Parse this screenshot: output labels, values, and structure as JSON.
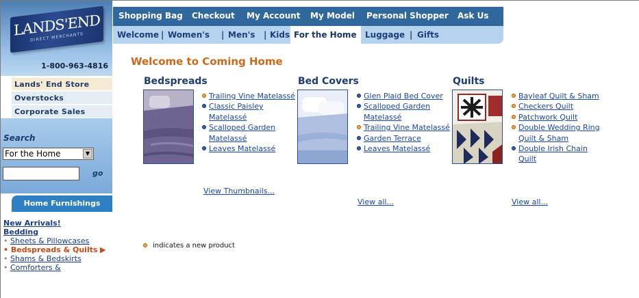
{
  "brand": {
    "logo_text": "LANDS'END",
    "logo_sub": "DIRECT MERCHANTS",
    "phone": "1-800-963-4816"
  },
  "stores": [
    {
      "label": "Lands' End Store"
    },
    {
      "label": "Overstocks"
    },
    {
      "label": "Corporate Sales"
    }
  ],
  "search": {
    "label": "Search",
    "selected": "For the Home",
    "go_label": "go",
    "input_value": ""
  },
  "top_nav": [
    "Shopping Bag",
    "Checkout",
    "My Account",
    "My Model",
    "Personal Shopper",
    "Ask Us"
  ],
  "sub_nav": [
    "Welcome",
    "Women's",
    "Men's",
    "Kids'",
    "For the Home",
    "Luggage",
    "Gifts"
  ],
  "sidebar_section": {
    "title": "Home Furnishings",
    "new_arrivals": "New Arrivals!",
    "bedding": "Bedding",
    "items": [
      "Sheets & Pillowcases",
      "Bedspreads & Quilts",
      "Shams & Bedskirts",
      "Comforters &"
    ],
    "current_index": 1,
    "current_marker": "▶"
  },
  "page": {
    "title": "Welcome to Coming Home"
  },
  "categories": [
    {
      "title": "Bedspreads",
      "items": [
        {
          "label": "Trailing Vine Matelassé",
          "new": true
        },
        {
          "label": "Classic Paisley Matelassé",
          "new": false
        },
        {
          "label": "Scalloped Garden Matelassé",
          "new": false
        },
        {
          "label": "Leaves Matelassé",
          "new": false
        }
      ],
      "view_link": "View Thumbnails..."
    },
    {
      "title": "Bed Covers",
      "items": [
        {
          "label": "Glen Plaid Bed Cover",
          "new": false
        },
        {
          "label": "Scalloped Garden Matelassé",
          "new": false
        },
        {
          "label": "Trailing Vine Matelassé",
          "new": true
        },
        {
          "label": "Garden Terrace",
          "new": false
        },
        {
          "label": "Leaves Matelassé",
          "new": false
        }
      ],
      "view_link": "View all..."
    },
    {
      "title": "Quilts",
      "items": [
        {
          "label": "Bayleaf Quilt & Sham",
          "new": true
        },
        {
          "label": "Checkers Quilt",
          "new": true
        },
        {
          "label": "Patchwork Quilt",
          "new": true
        },
        {
          "label": "Double Wedding Ring Quilt & Sham",
          "new": true
        },
        {
          "label": "Double Irish Chain Quilt",
          "new": false
        }
      ],
      "view_link": "View all..."
    }
  ],
  "legend": {
    "text": "indicates a new product"
  },
  "colors": {
    "nav_dark": "#30679d",
    "nav_light": "#b5d3ef",
    "accent_orange": "#cd6a1a",
    "link_blue": "#1a46a8",
    "new_dot": "#f4a63a",
    "std_dot": "#2e62b8"
  }
}
